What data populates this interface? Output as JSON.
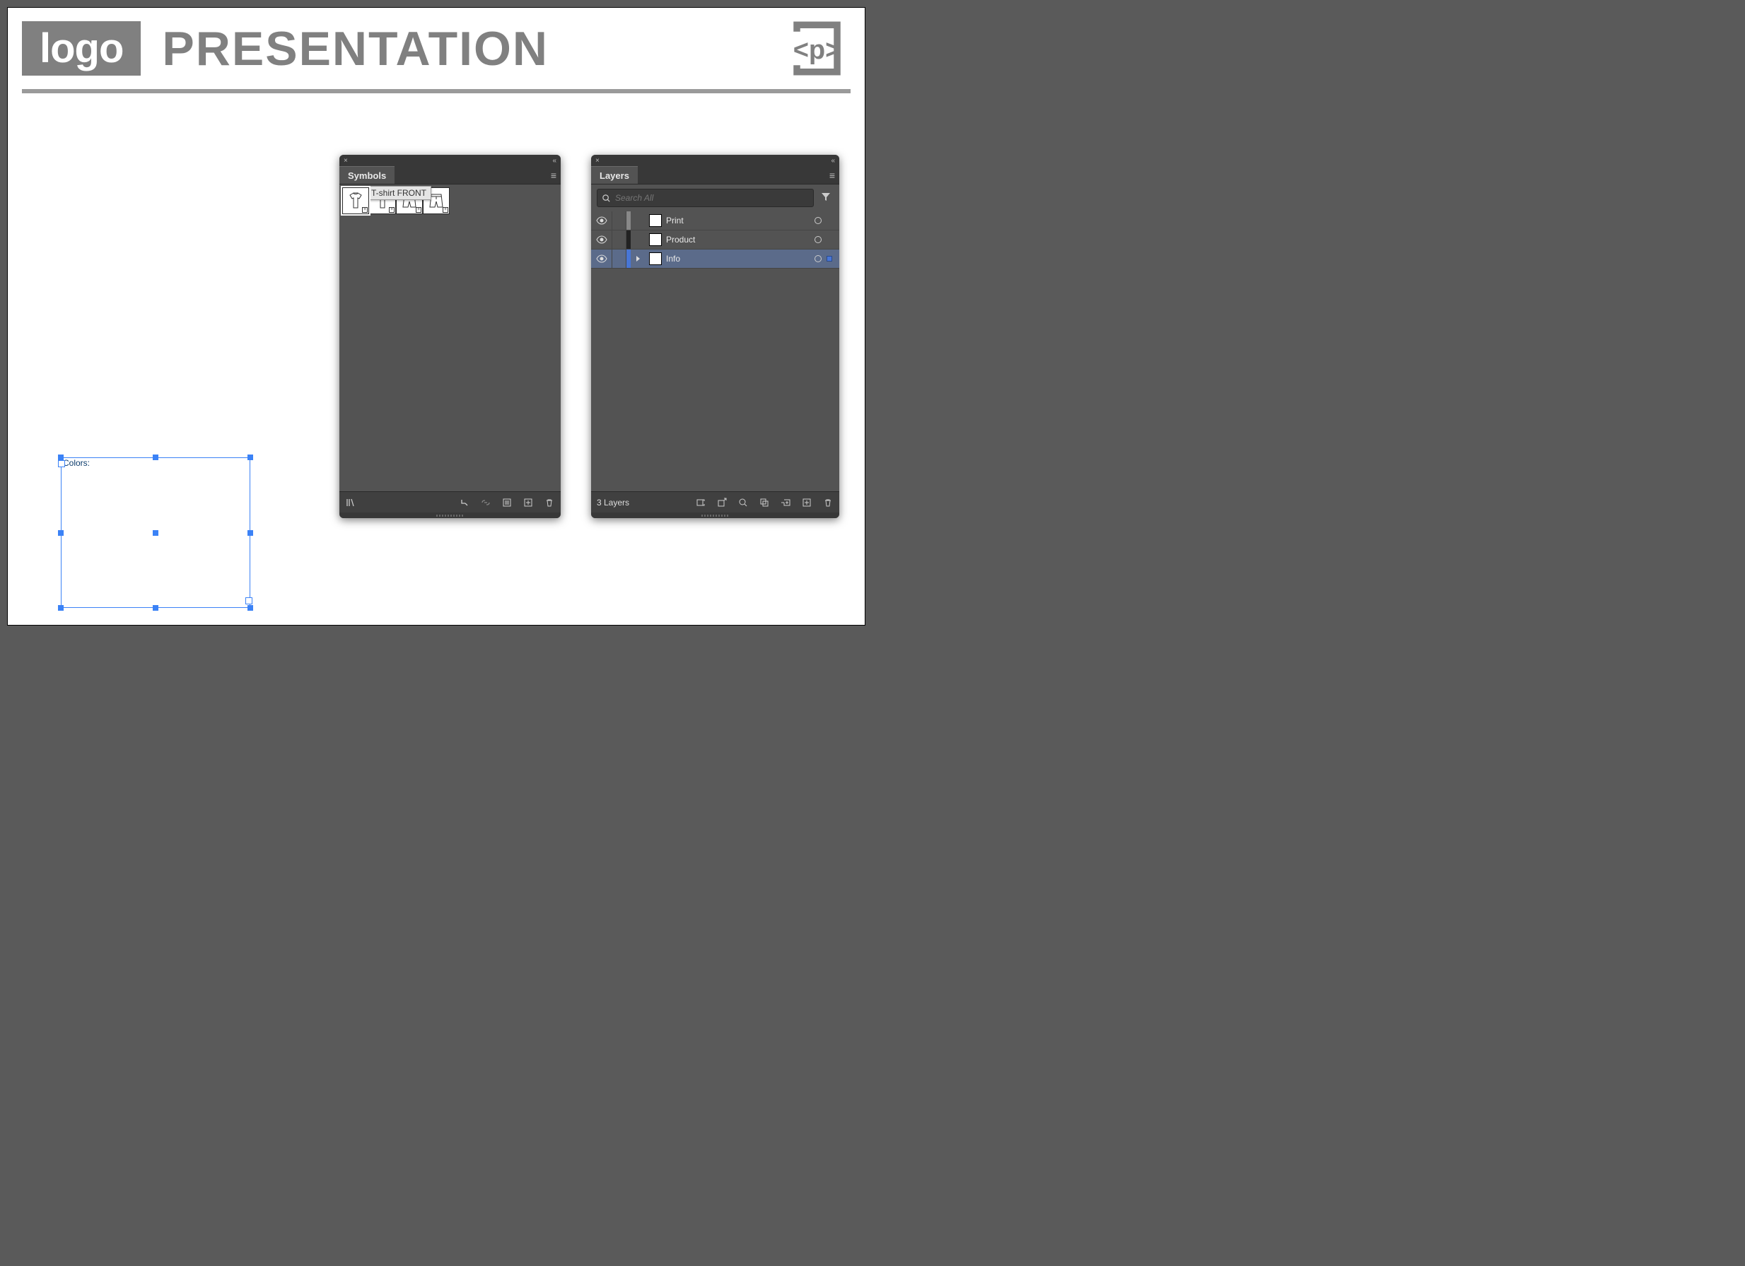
{
  "header": {
    "logo_label": "logo",
    "title": "PRESENTATION",
    "brand_text": "<p>"
  },
  "selection": {
    "label": "Colors:"
  },
  "symbols_panel": {
    "tab": "Symbols",
    "tooltip": "T-shirt FRONT",
    "items": [
      {
        "name": "tshirt-front",
        "selected": true
      },
      {
        "name": "tshirt-back",
        "selected": false
      },
      {
        "name": "shorts-front",
        "selected": false
      },
      {
        "name": "shorts-back",
        "selected": false
      }
    ]
  },
  "layers_panel": {
    "tab": "Layers",
    "search_placeholder": "Search All",
    "layers": [
      {
        "name": "Print",
        "color": "#888888",
        "selected": false,
        "expandable": false
      },
      {
        "name": "Product",
        "color": "#222222",
        "selected": false,
        "expandable": false
      },
      {
        "name": "Info",
        "color": "#4876d6",
        "selected": true,
        "expandable": true
      }
    ],
    "footer_count": "3 Layers"
  }
}
